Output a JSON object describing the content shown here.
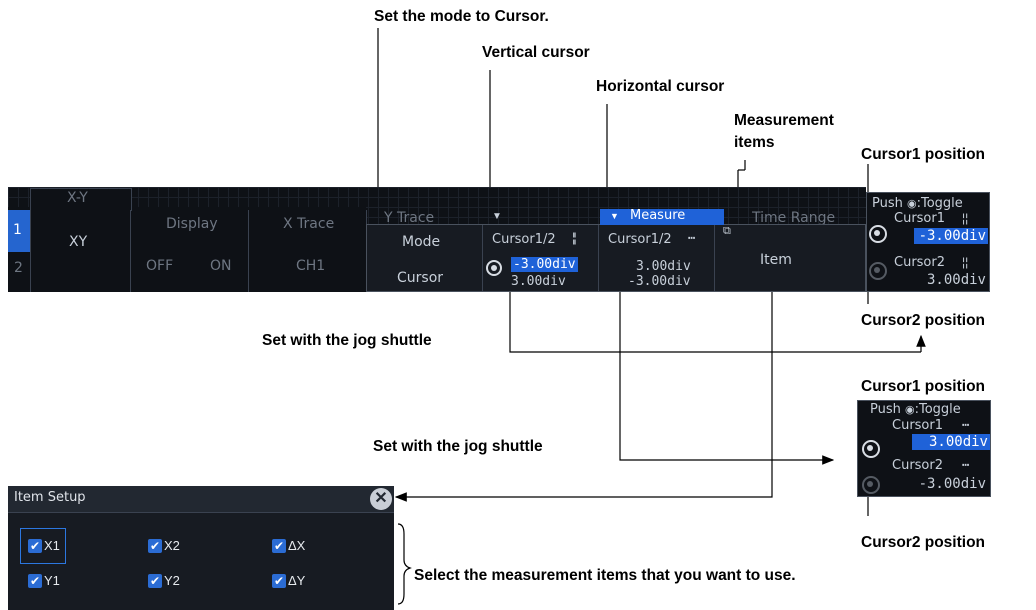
{
  "annotations": {
    "set_mode": "Set the mode to Cursor.",
    "vertical_cursor": "Vertical cursor",
    "horizontal_cursor": "Horizontal cursor",
    "measurement_items": "Measurement\nitems",
    "cursor1_position_top": "Cursor1 position",
    "cursor2_position_top": "Cursor2 position",
    "jog_shuttle_1": "Set with the jog shuttle",
    "cursor1_position_bottom": "Cursor1 position",
    "jog_shuttle_2": "Set with the jog shuttle",
    "cursor2_position_bottom": "Cursor2 position",
    "select_items": "Select the measurement items that you want to use."
  },
  "base_menu": {
    "tab": "X-Y",
    "left_num_top": "1",
    "left_num_bottom": "2",
    "xy_label": "XY",
    "display_label": "Display",
    "display_off": "OFF",
    "display_on": "ON",
    "xtrace_label": "X Trace",
    "xtrace_value": "CH1",
    "ytrace_label": "Y Trace",
    "time_range_label": "Time Range"
  },
  "cursor_menu": {
    "measure_tab": "Measure",
    "mode_label": "Mode",
    "mode_value": "Cursor",
    "vert_title": "Cursor1/2",
    "vert_val1": "-3.00div",
    "vert_val2": "3.00div",
    "horiz_title": "Cursor1/2",
    "horiz_val1": "3.00div",
    "horiz_val2": "-3.00div",
    "item_label": "Item"
  },
  "panel_top": {
    "push_toggle": "Push ",
    "toggle_word": ":Toggle",
    "cursor1_label": "Cursor1",
    "cursor1_value": "-3.00div",
    "cursor2_label": "Cursor2",
    "cursor2_value": "3.00div"
  },
  "panel_bottom": {
    "push_toggle": "Push ",
    "toggle_word": ":Toggle",
    "cursor1_label": "Cursor1",
    "cursor1_value": "3.00div",
    "cursor2_label": "Cursor2",
    "cursor2_value": "-3.00div"
  },
  "item_setup": {
    "title": "Item Setup",
    "items": [
      "X1",
      "X2",
      "ΔX",
      "Y1",
      "Y2",
      "ΔY"
    ]
  }
}
